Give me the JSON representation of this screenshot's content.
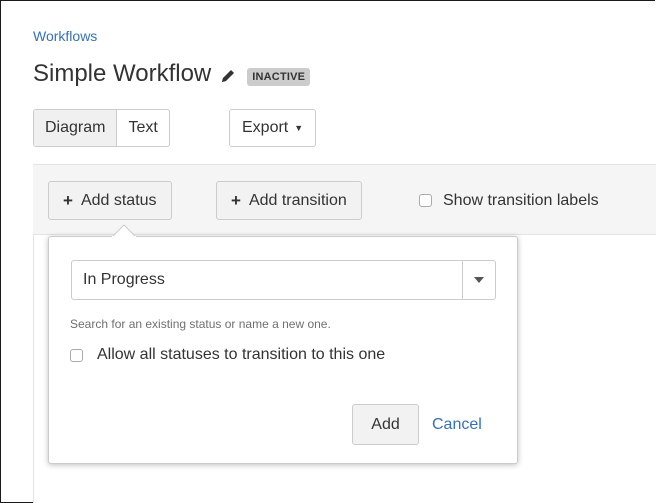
{
  "header": {
    "breadcrumb": "Workflows",
    "title": "Simple Workflow",
    "status_lozenge": "INACTIVE"
  },
  "view_toggle": {
    "diagram": "Diagram",
    "text": "Text",
    "active": "Diagram"
  },
  "export": {
    "label": "Export"
  },
  "toolbar": {
    "add_status": "Add status",
    "add_transition": "Add transition",
    "show_labels": "Show transition labels",
    "show_labels_checked": false
  },
  "popup": {
    "status_value": "In Progress",
    "hint": "Search for an existing status or name a new one.",
    "allow_all_label": "Allow all statuses to transition to this one",
    "allow_all_checked": false,
    "add_label": "Add",
    "cancel_label": "Cancel"
  },
  "colors": {
    "link": "#3572b0",
    "lozenge_bg": "#cccccc",
    "toolbar_bg": "#f5f5f5"
  },
  "icons": [
    "pencil-icon",
    "plus-icon",
    "chevron-down-icon"
  ]
}
